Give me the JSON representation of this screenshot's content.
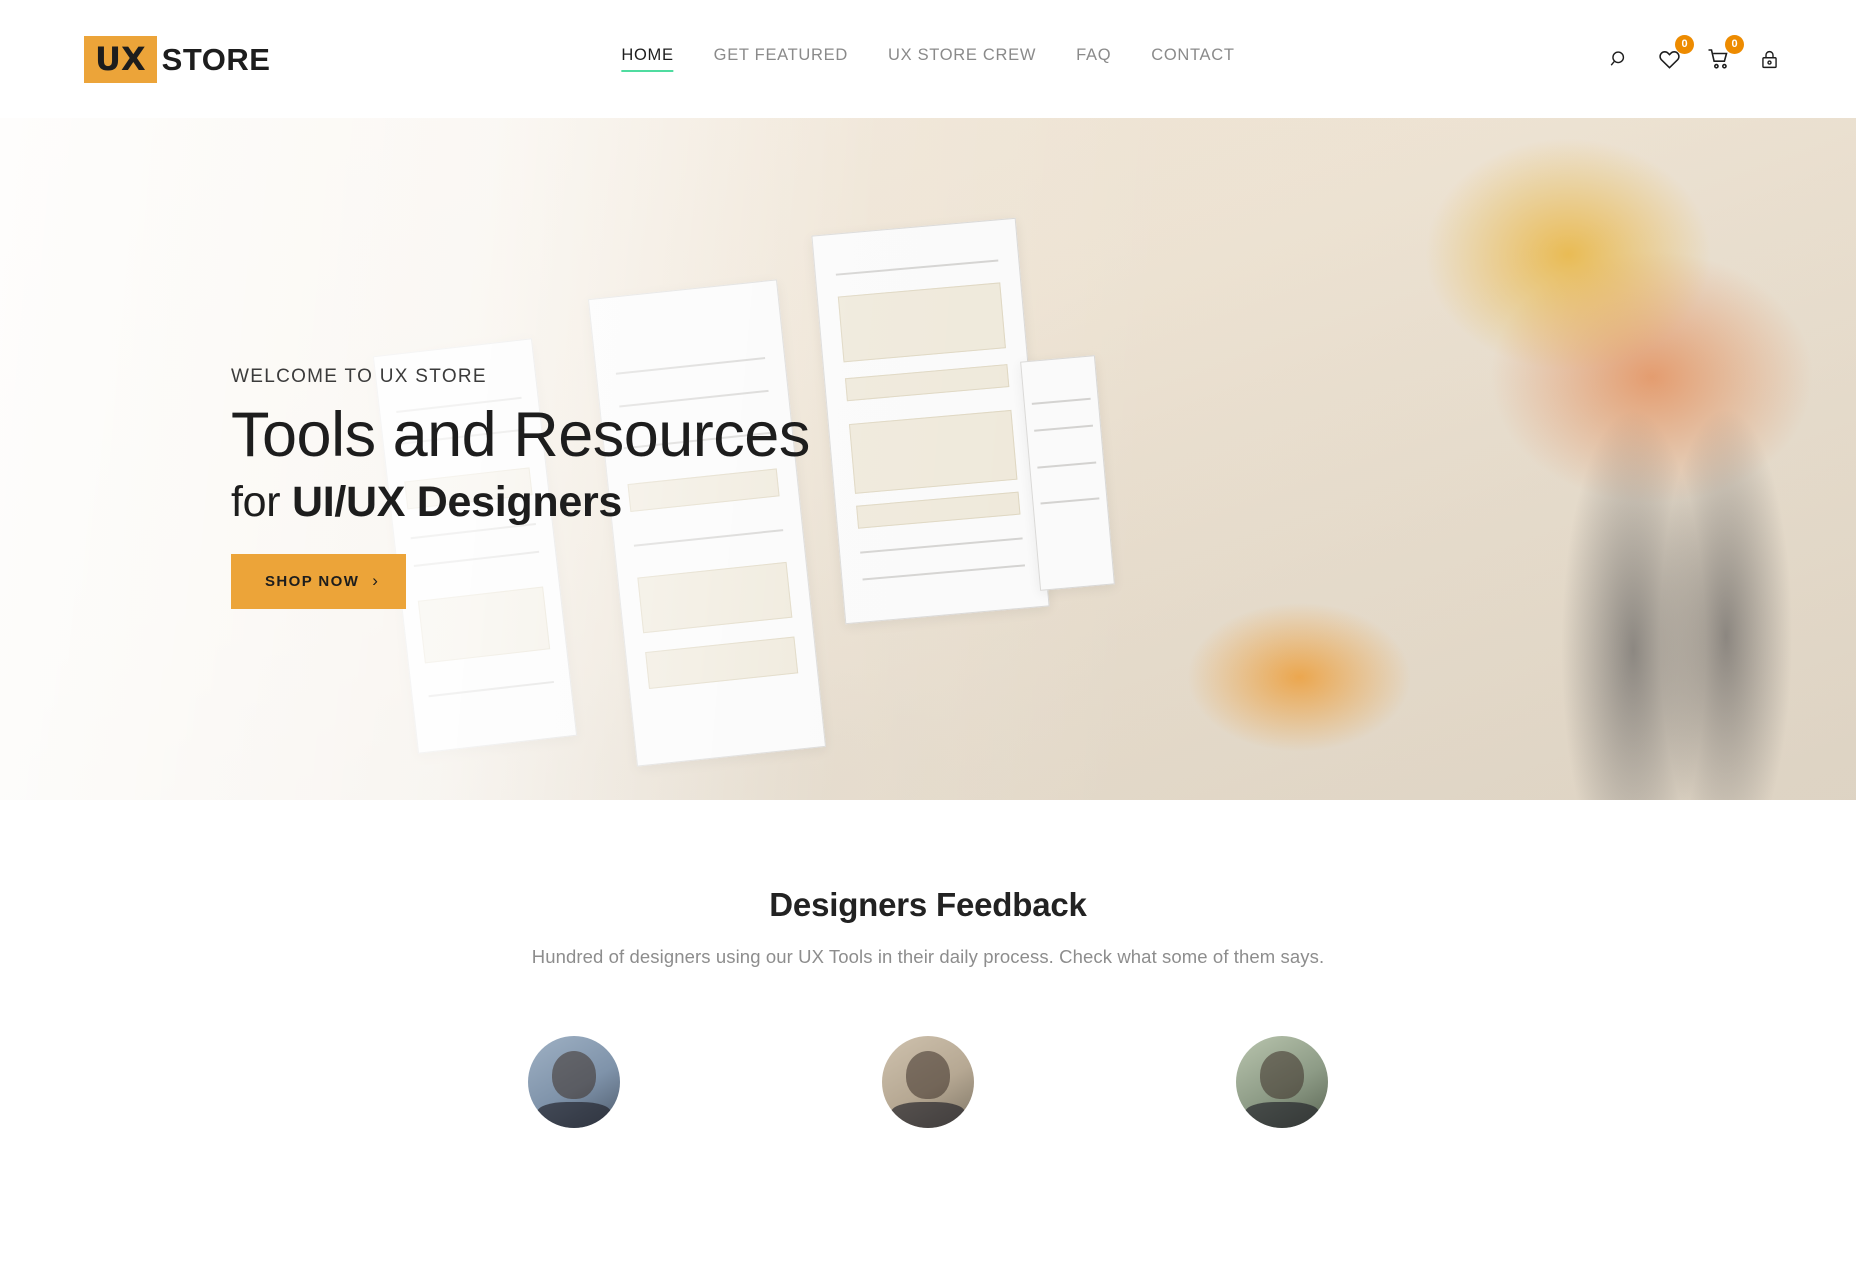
{
  "header": {
    "logo": {
      "badge": "UX",
      "text": "STORE"
    },
    "nav": [
      {
        "label": "HOME",
        "active": true
      },
      {
        "label": "GET FEATURED",
        "active": false
      },
      {
        "label": "UX STORE CREW",
        "active": false
      },
      {
        "label": "FAQ",
        "active": false
      },
      {
        "label": "CONTACT",
        "active": false
      }
    ],
    "icons": [
      {
        "name": "search-icon",
        "badge": null
      },
      {
        "name": "wishlist-heart-icon",
        "badge": "0"
      },
      {
        "name": "cart-icon",
        "badge": "0"
      },
      {
        "name": "lock-icon",
        "badge": null
      }
    ],
    "accent_color": "#ECA439",
    "active_underline_color": "#4fdca0",
    "badge_color": "#ED8B00"
  },
  "hero": {
    "eyebrow": "WELCOME TO UX STORE",
    "title": "Tools and Resources",
    "sub_prefix": "for ",
    "sub_strong": "UI/UX Designers",
    "cta_label": "SHOP NOW",
    "cta_chevron": "›"
  },
  "feedback": {
    "title": "Designers Feedback",
    "subtitle": "Hundred of designers using our UX Tools in their daily process. Check what some of them says.",
    "avatars": [
      {
        "name": "designer-avatar-1"
      },
      {
        "name": "designer-avatar-2"
      },
      {
        "name": "designer-avatar-3"
      }
    ]
  }
}
